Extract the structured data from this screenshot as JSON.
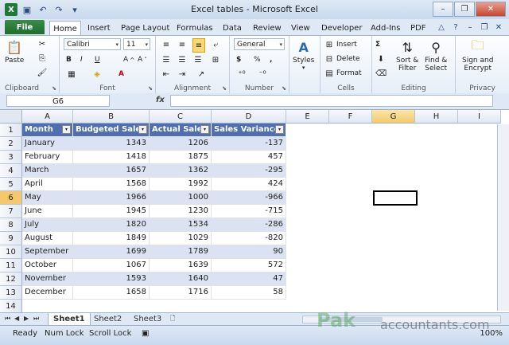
{
  "window": {
    "title": "Excel tables - Microsoft Excel"
  },
  "ribbon_tabs": [
    "File",
    "Home",
    "Insert",
    "Page Layout",
    "Formulas",
    "Data",
    "Review",
    "View",
    "Developer",
    "Add-Ins",
    "PDF"
  ],
  "clipboard": {
    "paste": "Paste",
    "label": "Clipboard"
  },
  "font": {
    "name": "Calibri",
    "size": "11",
    "label": "Font"
  },
  "alignment": {
    "label": "Alignment"
  },
  "number": {
    "format": "General",
    "label": "Number"
  },
  "styles": {
    "button": "Styles"
  },
  "cells": {
    "insert": "Insert",
    "delete": "Delete",
    "format": "Format",
    "label": "Cells"
  },
  "editing": {
    "sort": "Sort &",
    "filter": "Filter",
    "find": "Find &",
    "select": "Select",
    "label": "Editing"
  },
  "privacy": {
    "sign": "Sign and",
    "encrypt": "Encrypt",
    "label": "Privacy"
  },
  "formula_bar": {
    "name_box": "G6",
    "fx": "fx"
  },
  "columns": [
    "A",
    "B",
    "C",
    "D",
    "E",
    "F",
    "G",
    "H",
    "I"
  ],
  "rows": [
    "1",
    "2",
    "3",
    "4",
    "5",
    "6",
    "7",
    "8",
    "9",
    "10",
    "11",
    "12",
    "13",
    "14"
  ],
  "table": {
    "headers": [
      "Month",
      "Budgeted Sales",
      "Actual Sales",
      "Sales Variance"
    ],
    "data": [
      [
        "January",
        "1343",
        "1206",
        "-137"
      ],
      [
        "February",
        "1418",
        "1875",
        "457"
      ],
      [
        "March",
        "1657",
        "1362",
        "-295"
      ],
      [
        "April",
        "1568",
        "1992",
        "424"
      ],
      [
        "May",
        "1966",
        "1000",
        "-966"
      ],
      [
        "June",
        "1945",
        "1230",
        "-715"
      ],
      [
        "July",
        "1820",
        "1534",
        "-286"
      ],
      [
        "August",
        "1849",
        "1029",
        "-820"
      ],
      [
        "September",
        "1699",
        "1789",
        "90"
      ],
      [
        "October",
        "1067",
        "1639",
        "572"
      ],
      [
        "November",
        "1593",
        "1640",
        "47"
      ],
      [
        "December",
        "1658",
        "1716",
        "58"
      ]
    ]
  },
  "sheet_tabs": [
    "Sheet1",
    "Sheet2",
    "Sheet3"
  ],
  "status": {
    "ready": "Ready",
    "num_lock": "Num Lock",
    "scroll_lock": "Scroll Lock",
    "zoom": "100%"
  },
  "watermark": {
    "brand": "Pak",
    "site": "accountants.com"
  },
  "colors": {
    "header_blue": "#4f6fb0",
    "band": "#dbe3f3",
    "file_green": "#1e6e2e"
  }
}
